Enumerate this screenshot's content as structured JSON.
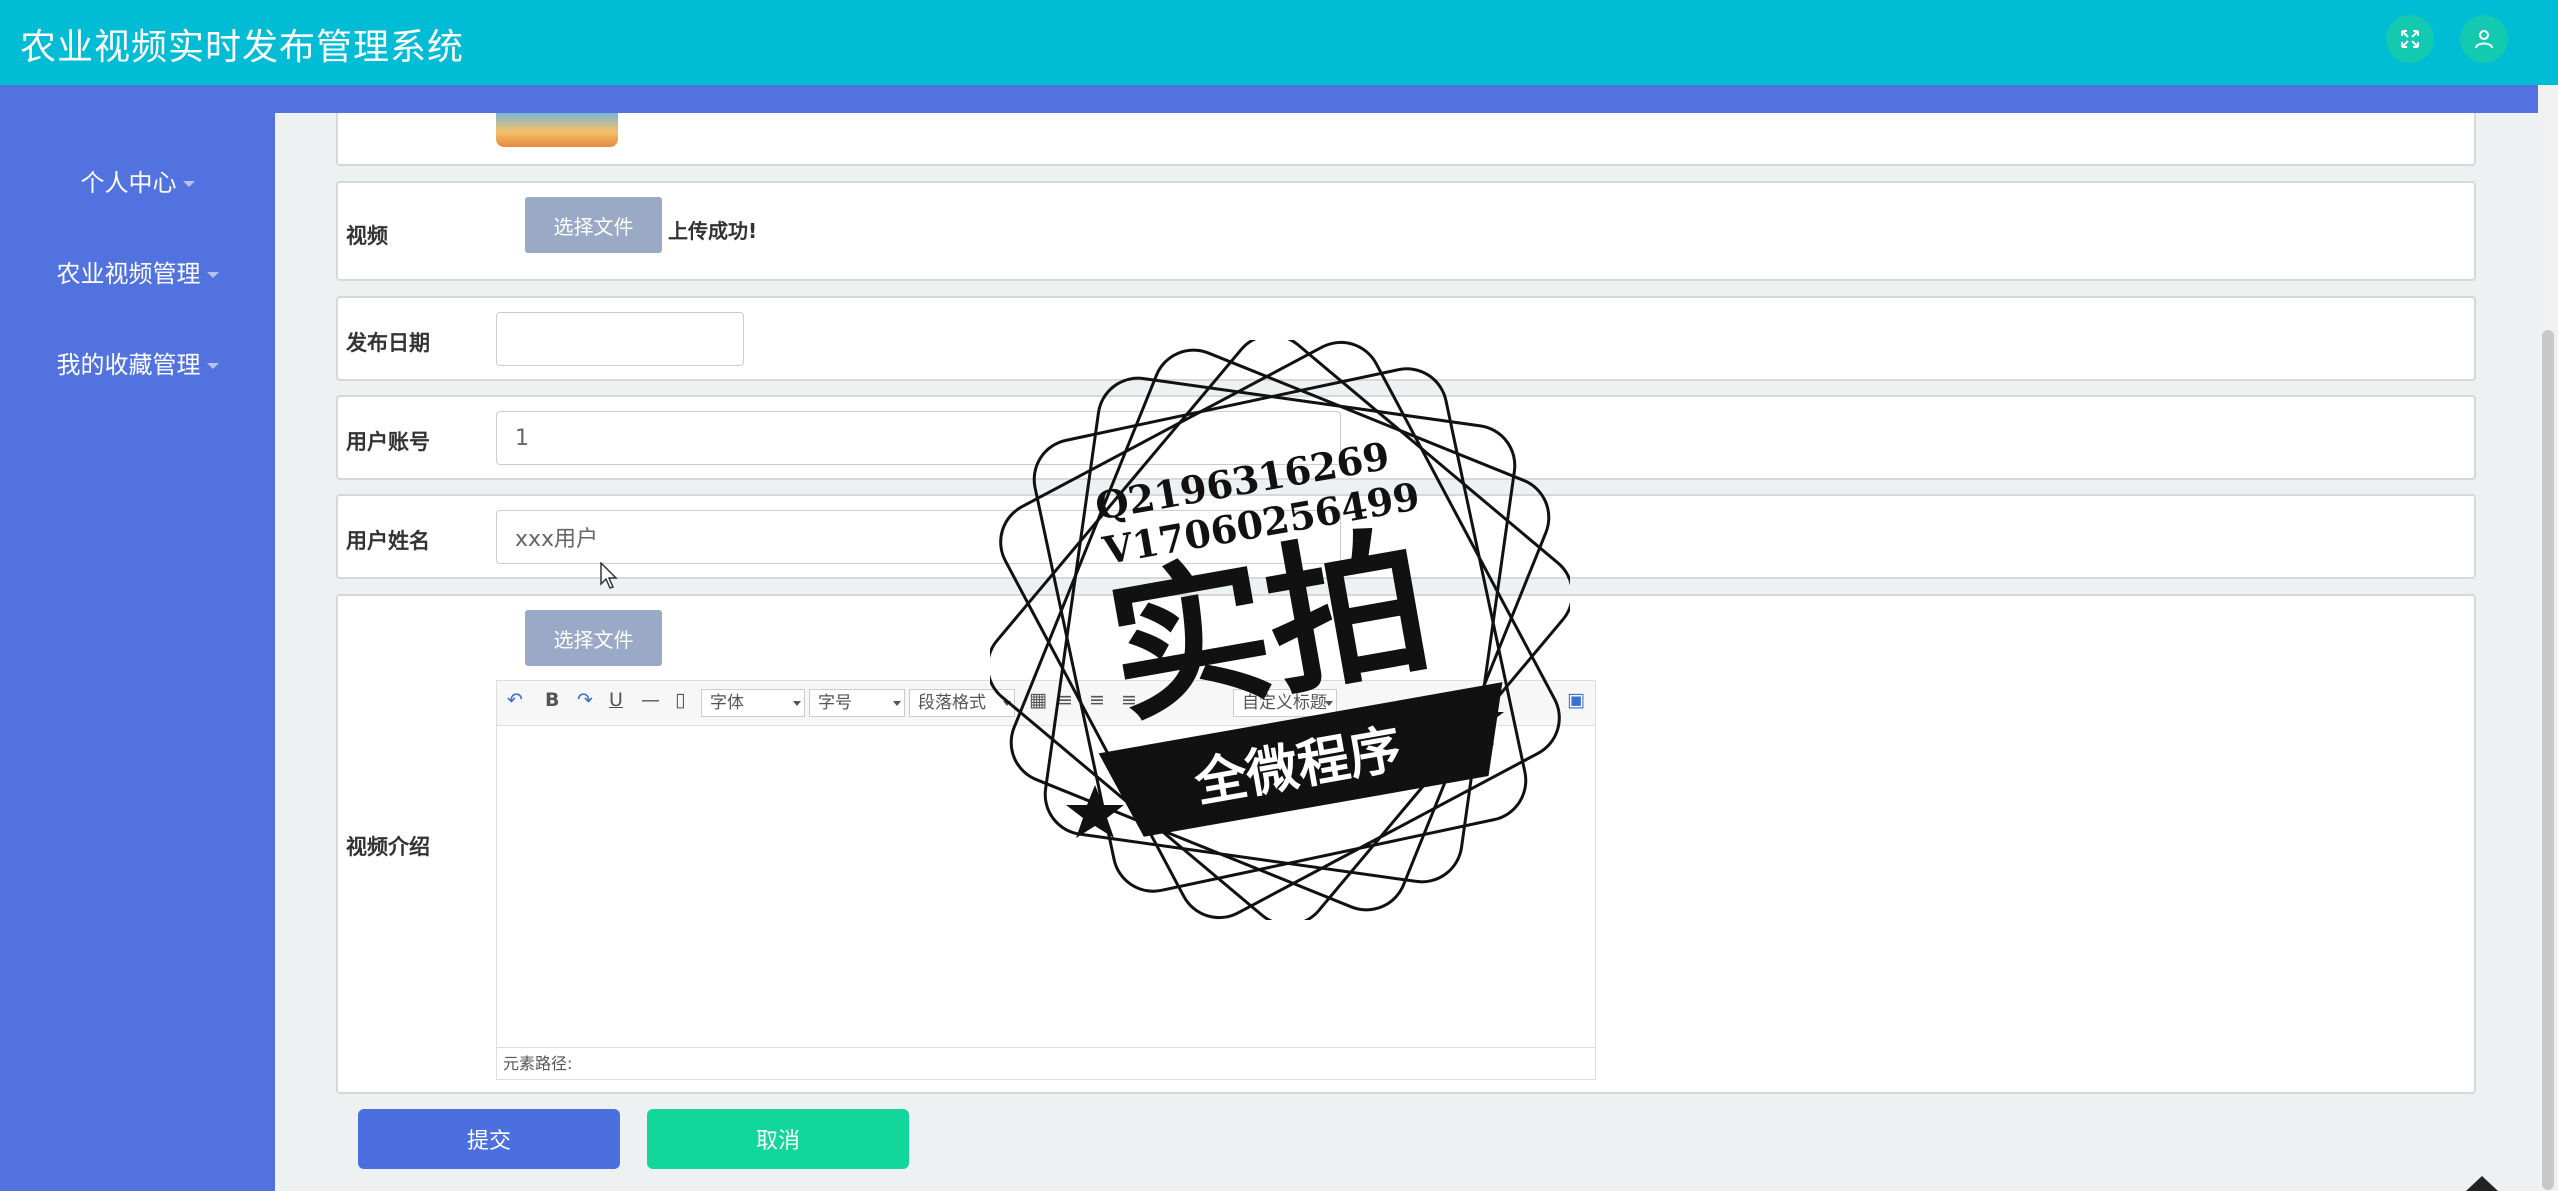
{
  "header": {
    "title": "农业视频实时发布管理系统"
  },
  "sidebar": {
    "items": [
      {
        "label": "个人中心"
      },
      {
        "label": "农业视频管理"
      },
      {
        "label": "我的收藏管理"
      }
    ]
  },
  "form": {
    "video": {
      "label": "视频",
      "button": "选择文件",
      "status": "上传成功!"
    },
    "publish_date": {
      "label": "发布日期",
      "value": ""
    },
    "user_account": {
      "label": "用户账号",
      "value": "1"
    },
    "user_name": {
      "label": "用户姓名",
      "value": "xxx用户"
    },
    "intro": {
      "label": "视频介绍",
      "button": "选择文件",
      "toolbar": {
        "font": "字体",
        "size": "字号",
        "paragraph": "段落格式",
        "custom_title": "自定义标题"
      },
      "status_path": "元素路径:"
    },
    "submit_label": "提交",
    "cancel_label": "取消"
  },
  "watermark": {
    "line1": "Q2196316269",
    "line2": "V17060256499",
    "main": "实拍",
    "ribbon": "全微程序"
  },
  "colors": {
    "header": "#00bcd4",
    "sidebar": "#5272e0",
    "submit": "#4c6fe0",
    "cancel": "#12d69a",
    "file_button": "#9aa9c5"
  }
}
